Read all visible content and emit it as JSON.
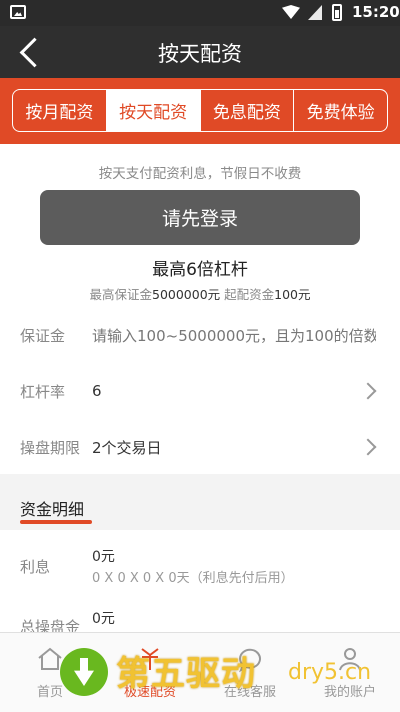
{
  "status_bar": {
    "time": "15:20"
  },
  "navbar": {
    "title": "按天配资"
  },
  "tabs": [
    {
      "label": "按月配资",
      "active": false
    },
    {
      "label": "按天配资",
      "active": true
    },
    {
      "label": "免息配资",
      "active": false
    },
    {
      "label": "免费体验",
      "active": false
    }
  ],
  "info": {
    "hint": "按天支付配资利息，节假日不收费",
    "toast": "请先登录",
    "leverage_title": "最高6倍杠杆",
    "limits_prefix": "最高保证金",
    "max_deposit": "5000000元",
    "limits_mid": " 起配资金",
    "min_amount": "100元"
  },
  "form": {
    "deposit_label": "保证金",
    "deposit_placeholder": "请输入100~5000000元，且为100的倍数",
    "leverage_label": "杠杆率",
    "leverage_value": "6",
    "period_label": "操盘期限",
    "period_value": "2个交易日"
  },
  "details": {
    "section_title": "资金明细",
    "interest_label": "利息",
    "interest_value": "0元",
    "interest_formula": "0 X 0 X 0 X 0天（利息先付后用）",
    "total_label": "总操盘金",
    "total_value": "0元"
  },
  "bottom_nav": [
    {
      "label": "首页",
      "icon": "home-icon"
    },
    {
      "label": "极速配资",
      "icon": "fund-icon"
    },
    {
      "label": "在线客服",
      "icon": "chat-icon"
    },
    {
      "label": "我的账户",
      "icon": "user-icon"
    }
  ],
  "watermark": {
    "text": "第五驱动",
    "url": "dry5.cn"
  },
  "colors": {
    "accent": "#e04a26",
    "dark": "#2f2f2f"
  }
}
